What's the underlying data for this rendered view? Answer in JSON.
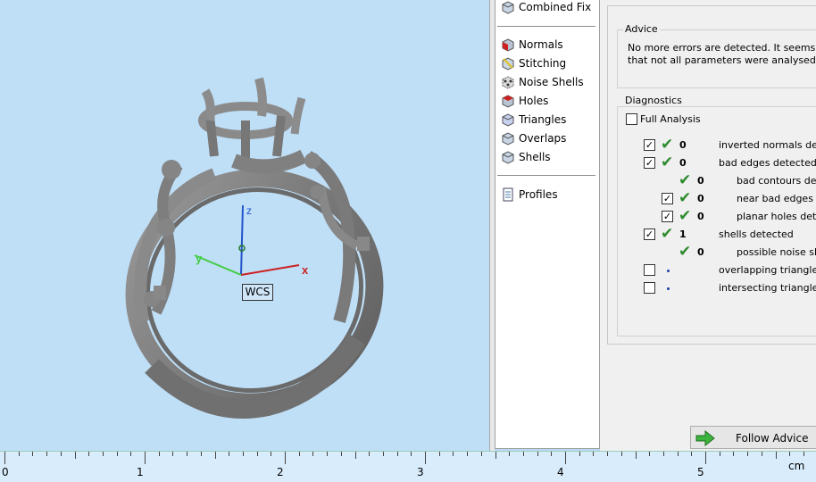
{
  "viewport": {
    "axis_labels": {
      "x": "x",
      "y": "y",
      "z": "z"
    },
    "wcs_label": "WCS"
  },
  "ruler": {
    "labels": [
      "0",
      "1",
      "2",
      "3",
      "4",
      "5"
    ],
    "unit": "cm"
  },
  "fix_list": {
    "top_item": {
      "label": "Combined Fix",
      "icon": "cube-icon"
    },
    "items": [
      {
        "label": "Normals",
        "icon": "cube-red-icon"
      },
      {
        "label": "Stitching",
        "icon": "cube-yellow-icon"
      },
      {
        "label": "Noise Shells",
        "icon": "cube-dotted-icon"
      },
      {
        "label": "Holes",
        "icon": "cube-red-icon"
      },
      {
        "label": "Triangles",
        "icon": "cube-wire-icon"
      },
      {
        "label": "Overlaps",
        "icon": "cube-icon"
      },
      {
        "label": "Shells",
        "icon": "cube-icon"
      }
    ],
    "profiles": {
      "label": "Profiles",
      "icon": "document-icon"
    }
  },
  "advice": {
    "title": "Advice",
    "text": "No more errors are detected. It seems that\nthat not all parameters were analysed."
  },
  "diagnostics": {
    "title": "Diagnostics",
    "full_analysis": {
      "label": "Full Analysis",
      "checked": false
    },
    "rows": [
      {
        "checked": true,
        "ok": true,
        "count": "0",
        "label": "inverted normals detec"
      },
      {
        "checked": true,
        "ok": true,
        "count": "0",
        "label": "bad edges detected"
      },
      {
        "checked": null,
        "ok": true,
        "count": "0",
        "label": "bad contours dete"
      },
      {
        "checked": true,
        "ok": true,
        "count": "0",
        "label": "near bad edges de"
      },
      {
        "checked": true,
        "ok": true,
        "count": "0",
        "label": "planar holes detec"
      },
      {
        "checked": true,
        "ok": true,
        "count": "1",
        "label": "shells detected"
      },
      {
        "checked": null,
        "ok": true,
        "count": "0",
        "label": "possible noise shel"
      },
      {
        "checked": false,
        "ok": false,
        "count": "",
        "label": "overlapping triangles d"
      },
      {
        "checked": false,
        "ok": false,
        "count": "",
        "label": "intersecting triangles d"
      }
    ]
  },
  "follow_advice": {
    "label": "Follow Advice",
    "icon": "green-arrow-icon"
  },
  "colors": {
    "viewport_bg": "#bfdff7",
    "model": "#7d7d7d",
    "check_green": "#2e8b2e",
    "axis_x": "#cc2222",
    "axis_y": "#44cc44",
    "axis_z": "#2255cc"
  }
}
